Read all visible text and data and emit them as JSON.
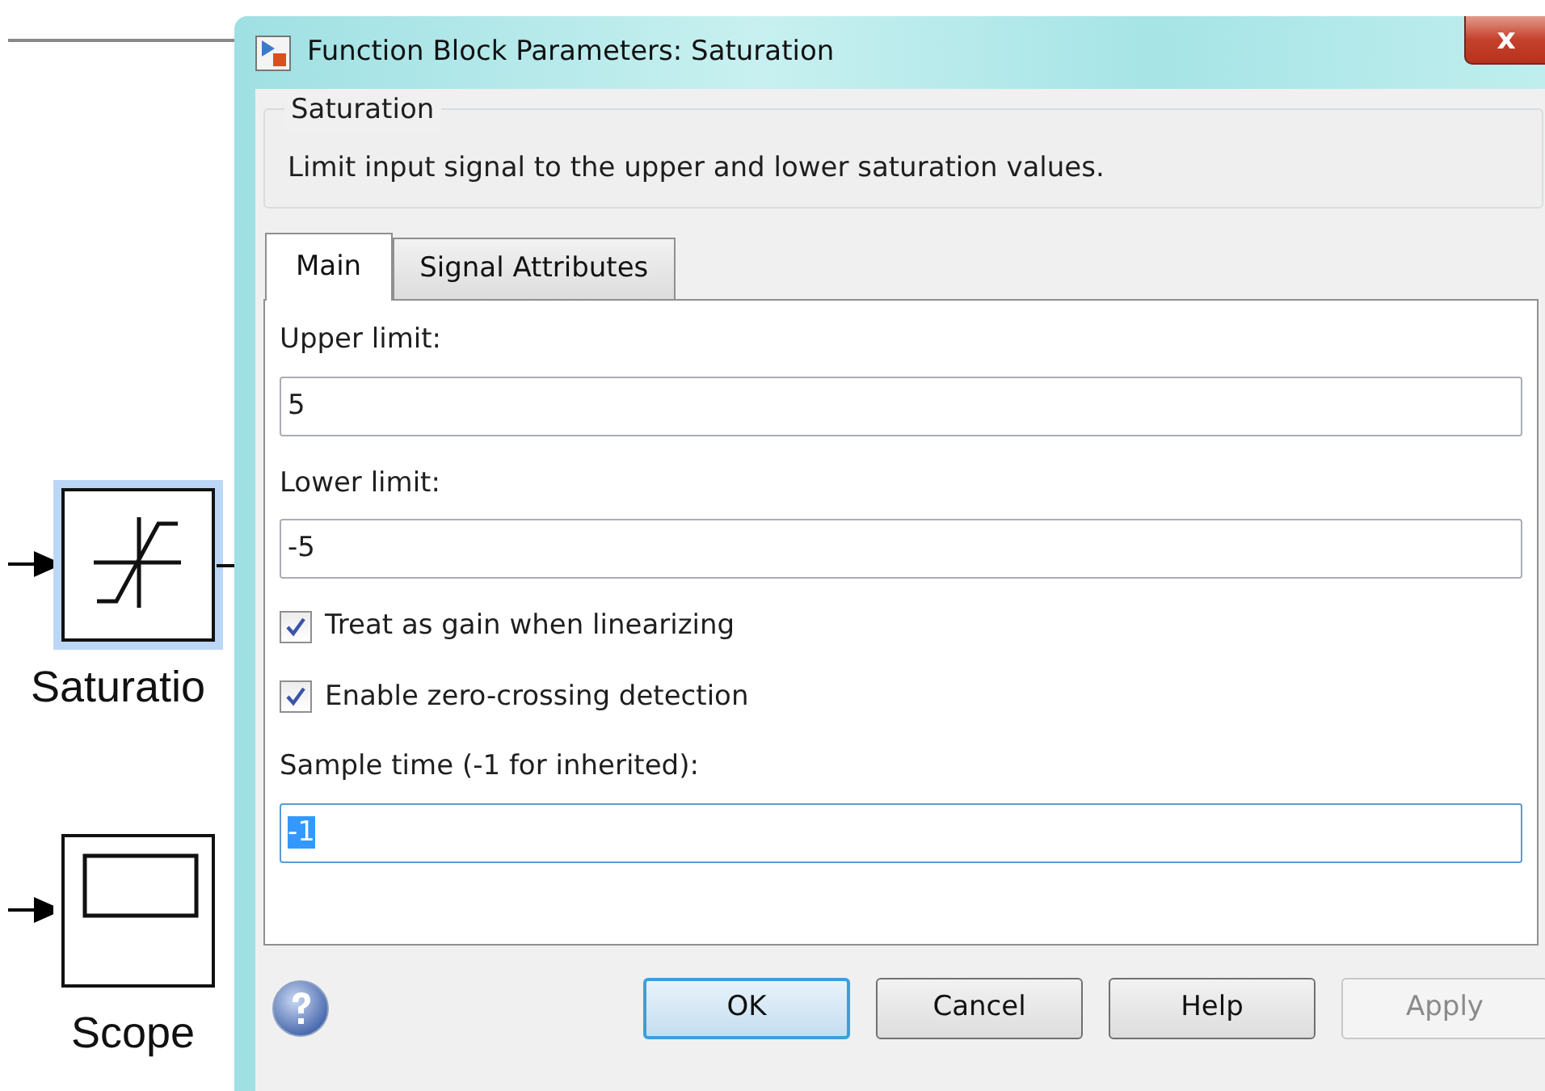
{
  "canvas": {
    "blocks": [
      {
        "kind": "saturation",
        "label": "Saturatio",
        "selected": true
      },
      {
        "kind": "scope",
        "label": "Scope",
        "selected": false
      }
    ]
  },
  "window": {
    "title": "Function Block Parameters: Saturation",
    "close_label": "x"
  },
  "group": {
    "title": "Saturation",
    "description": "Limit input signal to the upper and lower saturation values."
  },
  "tabs": [
    {
      "label": "Main",
      "selected": true
    },
    {
      "label": "Signal Attributes",
      "selected": false
    }
  ],
  "parameters": [
    {
      "kind": "field",
      "label": "Upper limit:",
      "value": "5",
      "text_selected": false
    },
    {
      "kind": "field",
      "label": "Lower limit:",
      "value": "-5",
      "text_selected": false
    },
    {
      "kind": "checkbox",
      "label": "Treat as gain when linearizing",
      "checked": true
    },
    {
      "kind": "checkbox",
      "label": "Enable zero-crossing detection",
      "checked": true
    },
    {
      "kind": "field",
      "label": "Sample time (-1 for inherited):",
      "value": "-1",
      "text_selected": true
    }
  ],
  "buttons": [
    {
      "label": "OK",
      "default": true,
      "disabled": false
    },
    {
      "label": "Cancel",
      "default": false,
      "disabled": false
    },
    {
      "label": "Help",
      "default": false,
      "disabled": false
    },
    {
      "label": "Apply",
      "default": false,
      "disabled": true
    }
  ]
}
